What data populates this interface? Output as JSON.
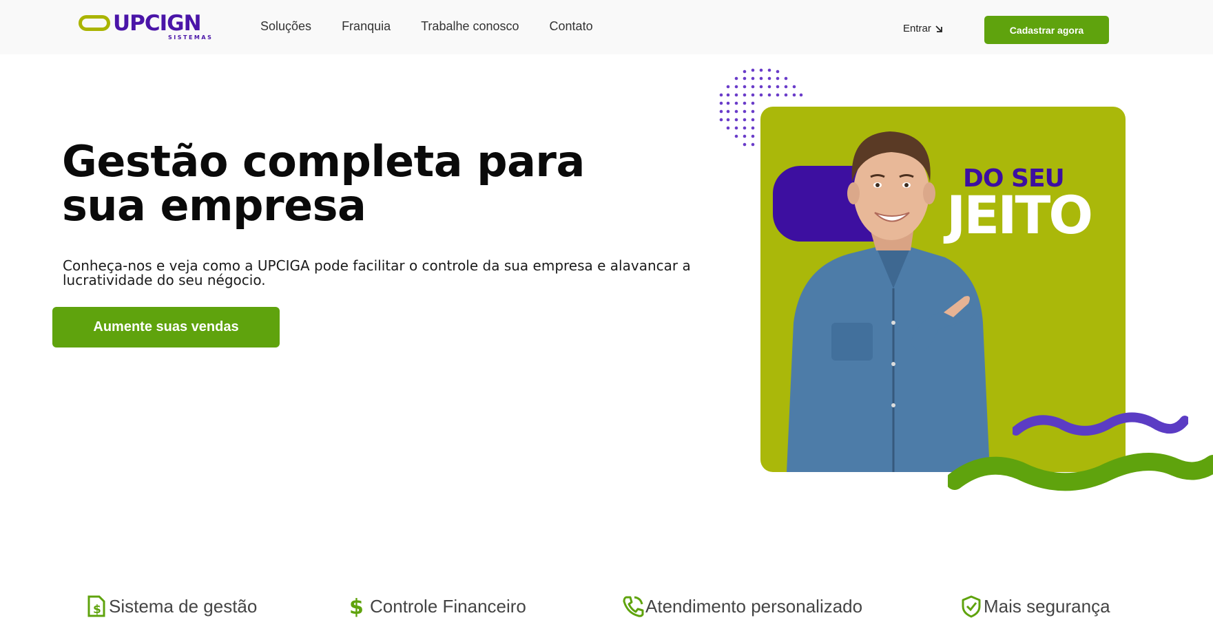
{
  "header": {
    "logo_text": "UPCIGN",
    "logo_sub": "SISTEMAS",
    "nav": [
      "Soluções",
      "Franquia",
      "Trabalhe conosco",
      "Contato"
    ],
    "login_label": "Entrar",
    "signup_label": "Cadastrar agora"
  },
  "hero": {
    "title": "Gestão completa para sua empresa",
    "text": "Conheça-nos e veja como a UPCIGA pode facilitar o controle da sua empresa e alavancar a lucratividade do seu négocio.",
    "cta_label": "Aumente suas vendas"
  },
  "image": {
    "slogan_small": "DO SEU",
    "slogan_big": "JEITO"
  },
  "features": [
    {
      "label": "Sistema de gestão",
      "icon": "invoice-dollar-icon"
    },
    {
      "label": "Controle Financeiro",
      "icon": "dollar-icon"
    },
    {
      "label": "Atendimento personalizado",
      "icon": "phone-icon"
    },
    {
      "label": "Mais segurança",
      "icon": "shield-check-icon"
    }
  ],
  "colors": {
    "brand_green": "#5fa30d",
    "brand_purple": "#4a15a8",
    "lime": "#aab80a"
  }
}
